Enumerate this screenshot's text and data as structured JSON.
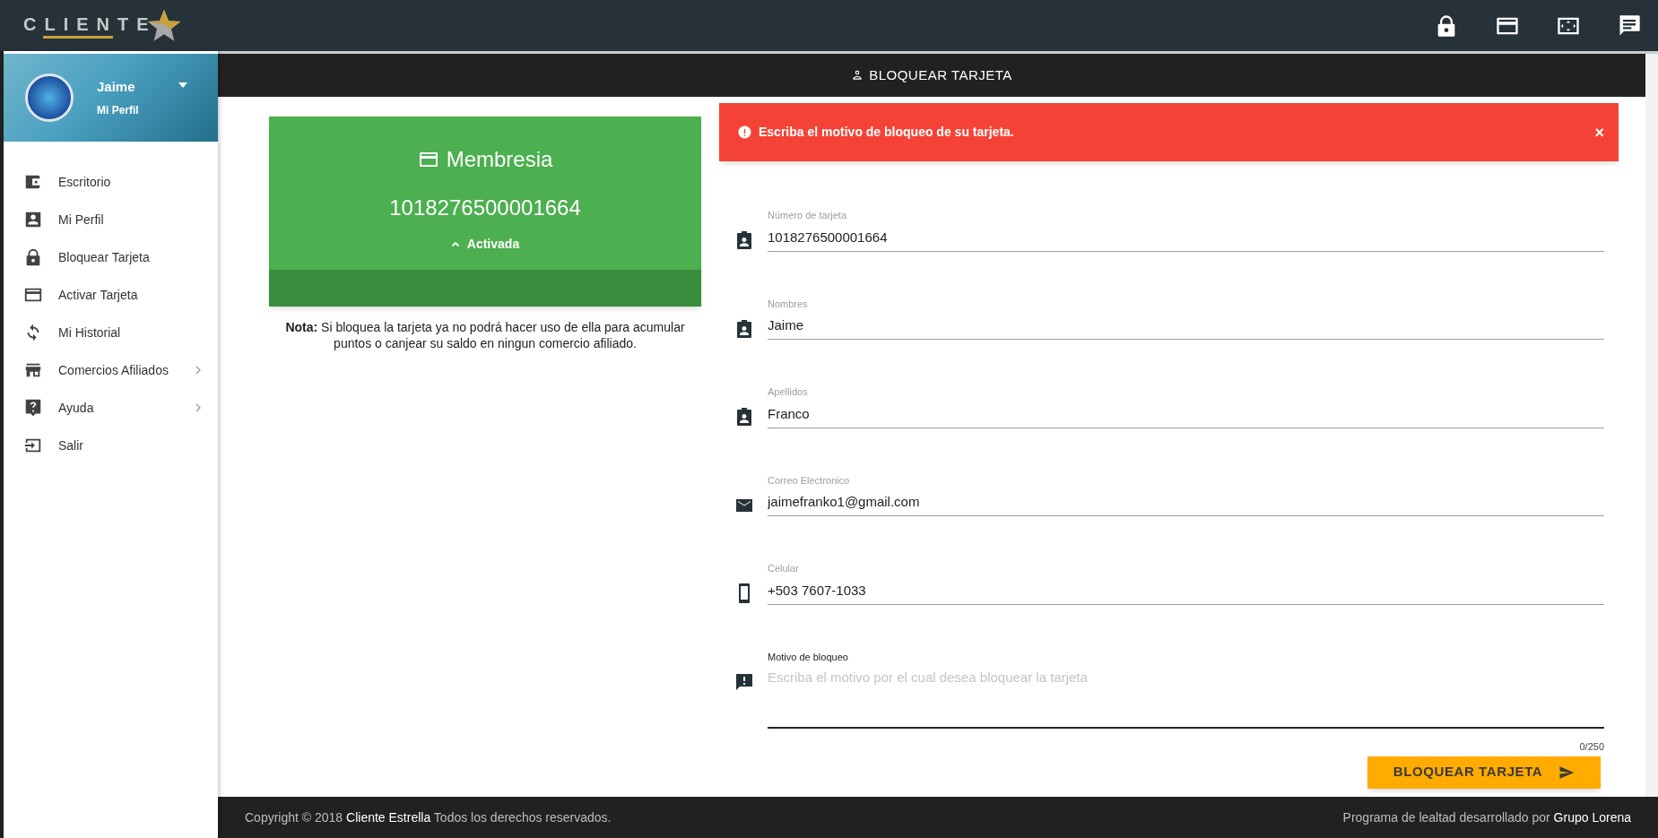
{
  "header": {
    "logo_text": "CLIENTE"
  },
  "profile": {
    "name": "Jaime",
    "subtitle": "Mi Perfil"
  },
  "sidebar": {
    "items": [
      {
        "label": "Escritorio",
        "expandable": false
      },
      {
        "label": "Mi Perfil",
        "expandable": false
      },
      {
        "label": "Bloquear Tarjeta",
        "expandable": false
      },
      {
        "label": "Activar Tarjeta",
        "expandable": false
      },
      {
        "label": "Mi Historial",
        "expandable": false
      },
      {
        "label": "Comercios Afiliados",
        "expandable": true
      },
      {
        "label": "Ayuda",
        "expandable": true
      },
      {
        "label": "Salir",
        "expandable": false
      }
    ]
  },
  "page_title": "BLOQUEAR TARJETA",
  "card": {
    "title": "Membresia",
    "number": "1018276500001664",
    "status": "Activada",
    "note": "**Nota:** Si bloquea la tarjeta ya no podrá hacer uso de ella para acumular puntos o canjear su saldo en ningun comercio afiliado."
  },
  "alert": {
    "message": "Escriba el motivo de bloqueo de su tarjeta.",
    "close": "×"
  },
  "form": {
    "fields": [
      {
        "kind": "text",
        "label": "Número de tarjeta",
        "value": "1018276500001664",
        "focused": false
      },
      {
        "kind": "text",
        "label": "Nombres",
        "value": "Jaime",
        "focused": false
      },
      {
        "kind": "text",
        "label": "Apellidos",
        "value": "Franco",
        "focused": false
      },
      {
        "kind": "text",
        "label": "Correo Electronico",
        "value": "jaimefranko1@gmail.com",
        "focused": false
      },
      {
        "kind": "text",
        "label": "Celular",
        "value": "+503 7607-1033",
        "focused": false
      },
      {
        "kind": "textarea",
        "label": "Motivo de bloqueo",
        "placeholder": "Escriba el motivo por el cual desea bloquear la tarjeta",
        "counter": "0/250",
        "focused": true
      }
    ],
    "submit": "BLOQUEAR TARJETA"
  },
  "footer": {
    "left": {
      "before": "Copyright © 2018",
      "link": "Cliente Estrella",
      "after": "Todos los derechos reservados."
    },
    "right": {
      "before": "Programa de lealtad desarrollado por",
      "link": "Grupo Lorena"
    }
  }
}
